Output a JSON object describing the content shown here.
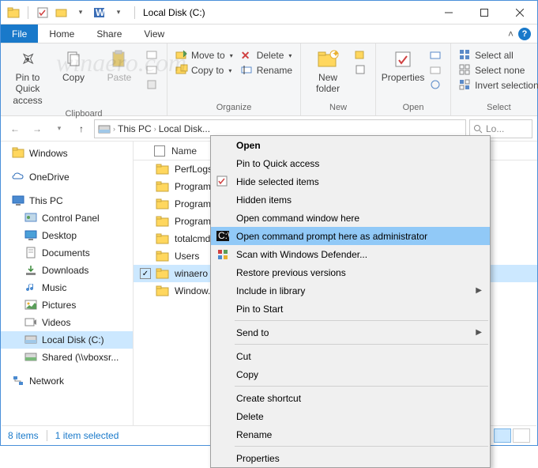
{
  "titlebar": {
    "title": "Local Disk (C:)"
  },
  "tabs": {
    "file": "File",
    "home": "Home",
    "share": "Share",
    "view": "View"
  },
  "ribbon": {
    "clipboard": {
      "label": "Clipboard",
      "pin": "Pin to Quick access",
      "copy": "Copy",
      "paste": "Paste"
    },
    "organize": {
      "label": "Organize",
      "moveto": "Move to",
      "copyto": "Copy to",
      "delete": "Delete",
      "rename": "Rename"
    },
    "new": {
      "label": "New",
      "newfolder": "New folder"
    },
    "open": {
      "label": "Open",
      "properties": "Properties"
    },
    "select": {
      "label": "Select",
      "all": "Select all",
      "none": "Select none",
      "invert": "Invert selection"
    }
  },
  "address": {
    "crumbs": [
      "This PC",
      "Local Disk..."
    ],
    "search_placeholder": "Lo..."
  },
  "nav": {
    "items": [
      {
        "label": "Windows",
        "icon": "win"
      },
      {
        "label": "OneDrive",
        "icon": "onedrive"
      },
      {
        "label": "This PC",
        "icon": "pc"
      },
      {
        "label": "Control Panel",
        "icon": "cp",
        "indent": 1
      },
      {
        "label": "Desktop",
        "icon": "desktop",
        "indent": 1
      },
      {
        "label": "Documents",
        "icon": "docs",
        "indent": 1
      },
      {
        "label": "Downloads",
        "icon": "dl",
        "indent": 1
      },
      {
        "label": "Music",
        "icon": "music",
        "indent": 1
      },
      {
        "label": "Pictures",
        "icon": "pics",
        "indent": 1
      },
      {
        "label": "Videos",
        "icon": "vids",
        "indent": 1
      },
      {
        "label": "Local Disk (C:)",
        "icon": "disk",
        "indent": 1,
        "selected": true
      },
      {
        "label": "Shared (\\\\vboxsr...",
        "icon": "netdrive",
        "indent": 1
      },
      {
        "label": "Network",
        "icon": "network"
      }
    ]
  },
  "columns": {
    "name": "Name"
  },
  "files": [
    {
      "name": "PerfLogs"
    },
    {
      "name": "Program..."
    },
    {
      "name": "Program..."
    },
    {
      "name": "Program..."
    },
    {
      "name": "totalcmd..."
    },
    {
      "name": "Users"
    },
    {
      "name": "winaero",
      "selected": true
    },
    {
      "name": "Window..."
    }
  ],
  "context_menu": {
    "items": [
      {
        "label": "Open",
        "bold": true
      },
      {
        "label": "Pin to Quick access"
      },
      {
        "label": "Hide selected items",
        "icon": "hide"
      },
      {
        "label": "Hidden items"
      },
      {
        "label": "Open command window here"
      },
      {
        "label": "Open command prompt here as administrator",
        "icon": "cmd",
        "selected": true
      },
      {
        "label": "Scan with Windows Defender...",
        "icon": "defender"
      },
      {
        "label": "Restore previous versions"
      },
      {
        "label": "Include in library",
        "submenu": true
      },
      {
        "label": "Pin to Start"
      },
      {
        "sep": true
      },
      {
        "label": "Send to",
        "submenu": true
      },
      {
        "sep": true
      },
      {
        "label": "Cut"
      },
      {
        "label": "Copy"
      },
      {
        "sep": true
      },
      {
        "label": "Create shortcut"
      },
      {
        "label": "Delete"
      },
      {
        "label": "Rename"
      },
      {
        "sep": true
      },
      {
        "label": "Properties"
      }
    ]
  },
  "status": {
    "count": "8 items",
    "selected": "1 item selected"
  }
}
